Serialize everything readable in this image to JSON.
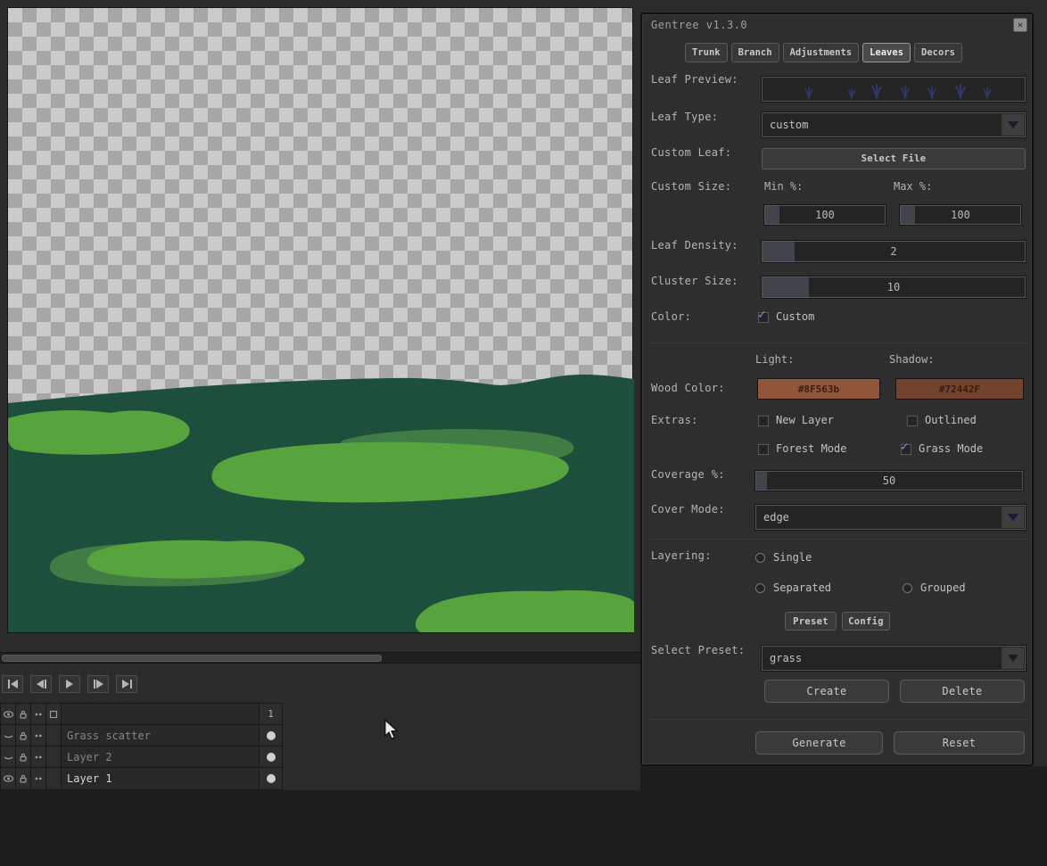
{
  "window": {
    "title": "Gentree v1.3.0",
    "close_icon": "✕"
  },
  "tabs": [
    {
      "label": "Trunk",
      "active": false
    },
    {
      "label": "Branch",
      "active": false
    },
    {
      "label": "Adjustments",
      "active": false
    },
    {
      "label": "Leaves",
      "active": true
    },
    {
      "label": "Decors",
      "active": false
    }
  ],
  "panel": {
    "leaf_preview_label": "Leaf Preview:",
    "leaf_type_label": "Leaf Type:",
    "leaf_type_value": "custom",
    "custom_leaf_label": "Custom Leaf:",
    "select_file_button": "Select File",
    "custom_size_label": "Custom Size:",
    "min_label": "Min %:",
    "min_value": "100",
    "max_label": "Max %:",
    "max_value": "100",
    "leaf_density_label": "Leaf Density:",
    "leaf_density_value": "2",
    "cluster_size_label": "Cluster Size:",
    "cluster_size_value": "10",
    "color_label": "Color:",
    "color_custom": {
      "label": "Custom",
      "checked": true
    },
    "light_label": "Light:",
    "shadow_label": "Shadow:",
    "wood_color_label": "Wood Color:",
    "wood_light": {
      "hex": "#8F563b"
    },
    "wood_shadow": {
      "hex": "#72442F"
    },
    "extras_label": "Extras:",
    "extras": [
      {
        "label": "New Layer",
        "checked": false
      },
      {
        "label": "Outlined",
        "checked": false
      },
      {
        "label": "Forest Mode",
        "checked": false
      },
      {
        "label": "Grass Mode",
        "checked": true
      }
    ],
    "coverage_label": "Coverage %:",
    "coverage_value": "50",
    "cover_mode_label": "Cover Mode:",
    "cover_mode_value": "edge",
    "layering_label": "Layering:",
    "layering": [
      {
        "label": "Single",
        "selected": false
      },
      {
        "label": "Separated",
        "selected": false
      },
      {
        "label": "Grouped",
        "selected": false
      }
    ],
    "preset_button": "Preset",
    "config_button": "Config",
    "select_preset_label": "Select Preset:",
    "preset_value": "grass",
    "create_button": "Create",
    "delete_button": "Delete",
    "generate_button": "Generate",
    "reset_button": "Reset"
  },
  "timeline": {
    "frame_number": "1",
    "layers": [
      {
        "name": "Grass scatter"
      },
      {
        "name": "Layer 2"
      },
      {
        "name": "Layer 1"
      }
    ]
  },
  "colors": {
    "terrain_base": "#1e4e3c",
    "terrain_light": "#57a33e",
    "terrain_medium": "#3f7d45",
    "check_accent": "#7e8ee0"
  }
}
